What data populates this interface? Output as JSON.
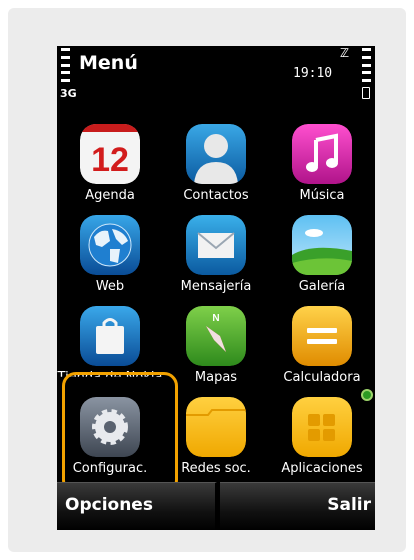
{
  "status": {
    "title": "Menú",
    "network": "3G",
    "time": "19:10"
  },
  "apps": [
    {
      "label": "Agenda",
      "icon": "calendar-icon",
      "badge": "12"
    },
    {
      "label": "Contactos",
      "icon": "contacts-icon"
    },
    {
      "label": "Música",
      "icon": "music-icon"
    },
    {
      "label": "Web",
      "icon": "globe-icon"
    },
    {
      "label": "Mensajería",
      "icon": "envelope-icon"
    },
    {
      "label": "Galería",
      "icon": "gallery-icon"
    },
    {
      "label": "Tienda de Nokia",
      "icon": "store-bag-icon"
    },
    {
      "label": "Mapas",
      "icon": "compass-icon",
      "compass_letter": "N"
    },
    {
      "label": "Calculadora",
      "icon": "calculator-icon"
    },
    {
      "label": "Configurac.",
      "icon": "settings-gear-icon"
    },
    {
      "label": "Redes soc.",
      "icon": "folder-icon"
    },
    {
      "label": "Aplicaciones",
      "icon": "apps-folder-icon"
    }
  ],
  "softkeys": {
    "left": "Opciones",
    "right": "Salir"
  },
  "colors": {
    "selection": "#f2a200",
    "notification": "#2c9a22"
  }
}
